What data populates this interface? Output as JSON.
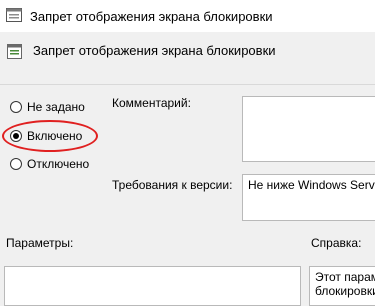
{
  "window": {
    "title": "Запрет отображения экрана блокировки"
  },
  "policy": {
    "heading": "Запрет отображения экрана блокировки"
  },
  "options": [
    {
      "label": "Не задано",
      "checked": false
    },
    {
      "label": "Включено",
      "checked": true
    },
    {
      "label": "Отключено",
      "checked": false
    }
  ],
  "comment": {
    "label": "Комментарий:",
    "value": ""
  },
  "requirements": {
    "label": "Требования к версии:",
    "value": "Не ниже Windows Server"
  },
  "parameters": {
    "label": "Параметры:"
  },
  "help": {
    "label": "Справка:",
    "lines": [
      "Этот парам",
      "блокировки"
    ]
  },
  "colors": {
    "highlight": "#e02020",
    "window_bg": "#f0f0f0"
  }
}
